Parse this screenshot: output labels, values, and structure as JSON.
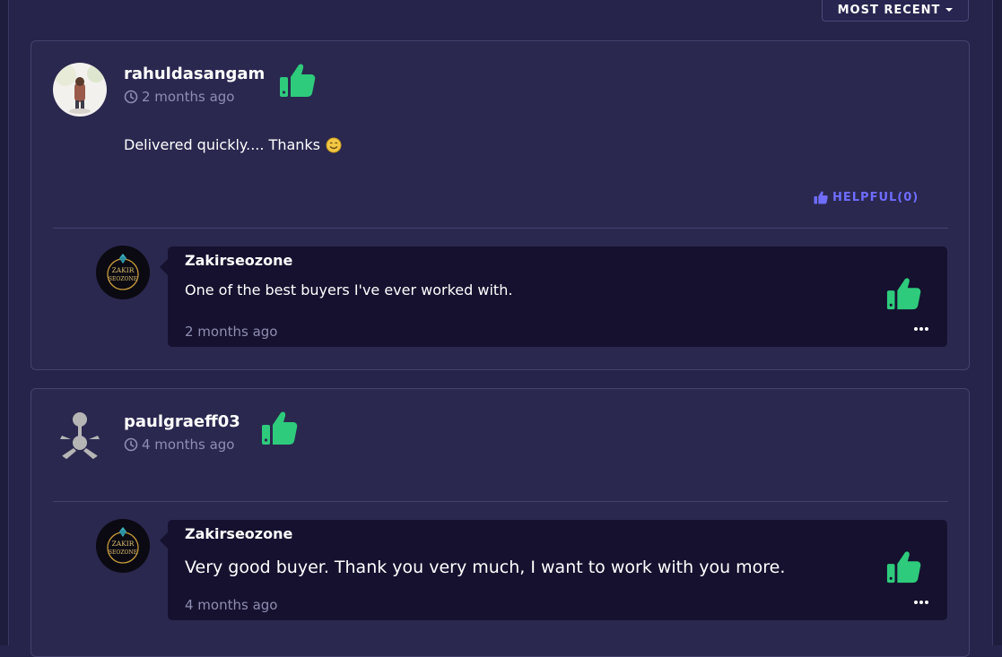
{
  "toolbar": {
    "sort_label": "MOST RECENT"
  },
  "colors": {
    "accent": "#6f6cff",
    "thumb": "#2ecb7c",
    "background": "#26244a",
    "card": "#2a284f",
    "reply": "#15112f"
  },
  "reviews": [
    {
      "username": "rahuldasangam",
      "time": "2 months ago",
      "text": "Delivered quickly.... Thanks",
      "helpful_label": "HELPFUL(0)",
      "rating_icon": "thumbs-up-icon",
      "reply": {
        "name": "Zakirseozone",
        "text": "One of the best buyers I've ever worked with.",
        "time": "2 months ago",
        "avatar_text": [
          "ZAKIR",
          "SEOZONE"
        ]
      }
    },
    {
      "username": "paulgraeff03",
      "time": "4 months ago",
      "rating_icon": "thumbs-up-icon",
      "reply": {
        "name": "Zakirseozone",
        "text": "Very good buyer. Thank you very much, I want to work with you more.",
        "time": "4 months ago",
        "avatar_text": [
          "ZAKIR",
          "SEOZONE"
        ]
      }
    }
  ]
}
